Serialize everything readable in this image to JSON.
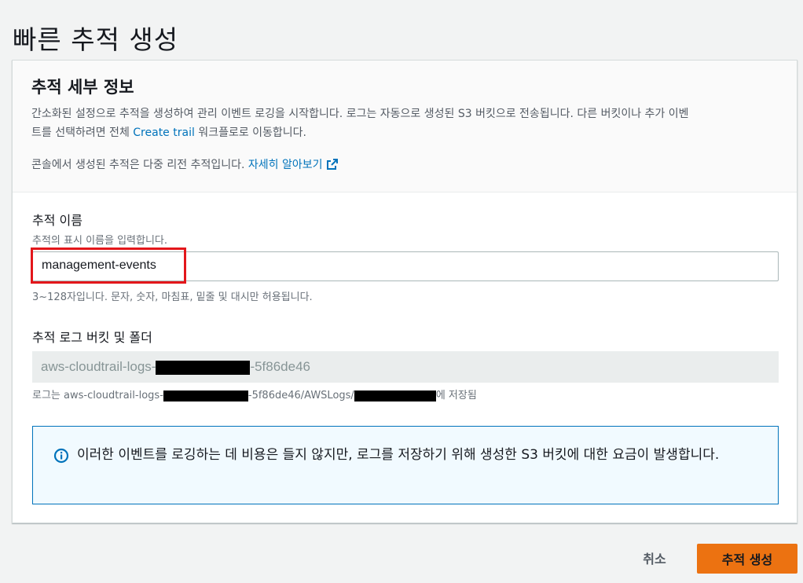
{
  "page": {
    "title": "빠른 추적 생성"
  },
  "details": {
    "title": "추적 세부 정보",
    "desc_line1": "간소화된 설정으로 추적을 생성하여 관리 이벤트 로깅을 시작합니다. 로그는 자동으로 생성된 S3 버킷으로 전송됩니다. 다른 버킷이나 추가 이벤",
    "desc_line2_prefix": "트를 선택하려면 전체 ",
    "desc_link": "Create trail",
    "desc_line2_suffix": " 워크플로로 이동합니다.",
    "multiregion_text": "콘솔에서 생성된 추적은 다중 리전 추적입니다. ",
    "learn_more": "자세히 알아보기"
  },
  "trail_name": {
    "label": "추적 이름",
    "description": "추적의 표시 이름을 입력합니다.",
    "value": "management-events",
    "constraint": "3~128자입니다. 문자, 숫자, 마침표, 밑줄 및 대시만 허용됩니다."
  },
  "bucket": {
    "label": "추적 로그 버킷 및 폴더",
    "value_prefix": "aws-cloudtrail-logs-",
    "value_suffix": "-5f86de46",
    "path_prefix": "로그는 aws-cloudtrail-logs-",
    "path_middle": "-5f86de46/AWSLogs/",
    "path_suffix": "에 저장됨"
  },
  "info": {
    "text": "이러한 이벤트를 로깅하는 데 비용은 들지 않지만, 로그를 저장하기 위해 생성한 S3 버킷에 대한 요금이 발생합니다."
  },
  "actions": {
    "cancel": "취소",
    "create": "추적 생성"
  },
  "colors": {
    "primary_button": "#ec7211",
    "link": "#0073bb",
    "info_border": "#0073bb",
    "highlight": "#e3171b"
  }
}
